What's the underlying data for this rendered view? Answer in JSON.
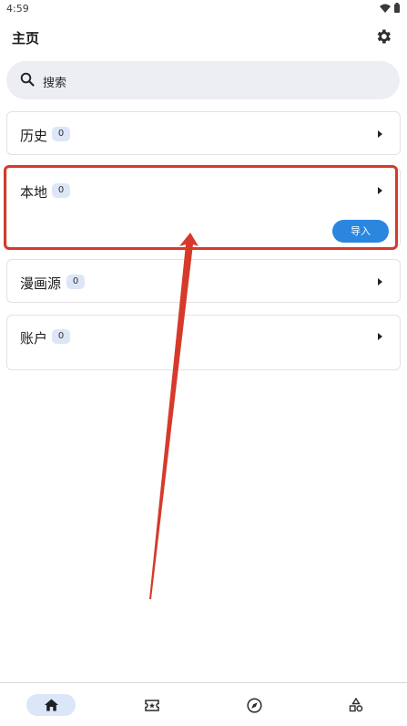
{
  "status_bar": {
    "time": "4:59"
  },
  "app_bar": {
    "title": "主页"
  },
  "search": {
    "placeholder": "搜索"
  },
  "cards": [
    {
      "label": "历史",
      "count": "0"
    },
    {
      "label": "本地",
      "count": "0",
      "action": "导入"
    },
    {
      "label": "漫画源",
      "count": "0"
    },
    {
      "label": "账户",
      "count": "0"
    }
  ],
  "colors": {
    "accent": "#2a86df",
    "highlight": "#d63a2b",
    "badge_bg": "#dde6f7",
    "search_bg": "#eceef4"
  },
  "bottom_nav": {
    "items": [
      {
        "icon": "home-icon",
        "active": true
      },
      {
        "icon": "ticket-star-icon",
        "active": false
      },
      {
        "icon": "compass-icon",
        "active": false
      },
      {
        "icon": "shapes-icon",
        "active": false
      }
    ]
  }
}
